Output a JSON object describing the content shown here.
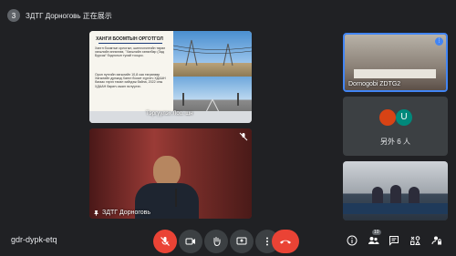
{
  "presenter": {
    "count": "3",
    "text": "ЗДТГ Дорноговь 正在展示"
  },
  "slide": {
    "title": "ХАНГИ БООМТЫН ОРГОТГОЛ",
    "bullet1": "Хангн боомтын орлогын, шинэчлэлтийн төрөл хөгжлийн өнгөлгөө, \"Хөгжлийн хөтөлбөр (Зад Бурсак\" бодлогын тухай тооцоо.",
    "bullet2": "Орон нутгийн хөгжлийн 10,8 сая төгрөгөөр Хөгжлийн дунжид Хангл боомт хүргэгч ХДААН багаас гэрээ төсөл хийгдэж байна, 2022 оны ХДААН баригч ажил эхлүүлэх.",
    "overlay": "Тэргүүлэх Лоо. шн"
  },
  "speaker": {
    "name": "ЗДТГ Дорноговь"
  },
  "tiles": {
    "top": {
      "name": "Dornogobi ZDTG2"
    },
    "others": {
      "avatar1": "",
      "avatar2": "U",
      "label": "另外 6 人"
    }
  },
  "bottom": {
    "meeting_code": "gdr-dypk-etq",
    "participants_badge": "10",
    "colors": {
      "end_call": "#ea4335",
      "bg": "#202124",
      "tile": "#3c4043",
      "accent": "#4285f4"
    }
  }
}
